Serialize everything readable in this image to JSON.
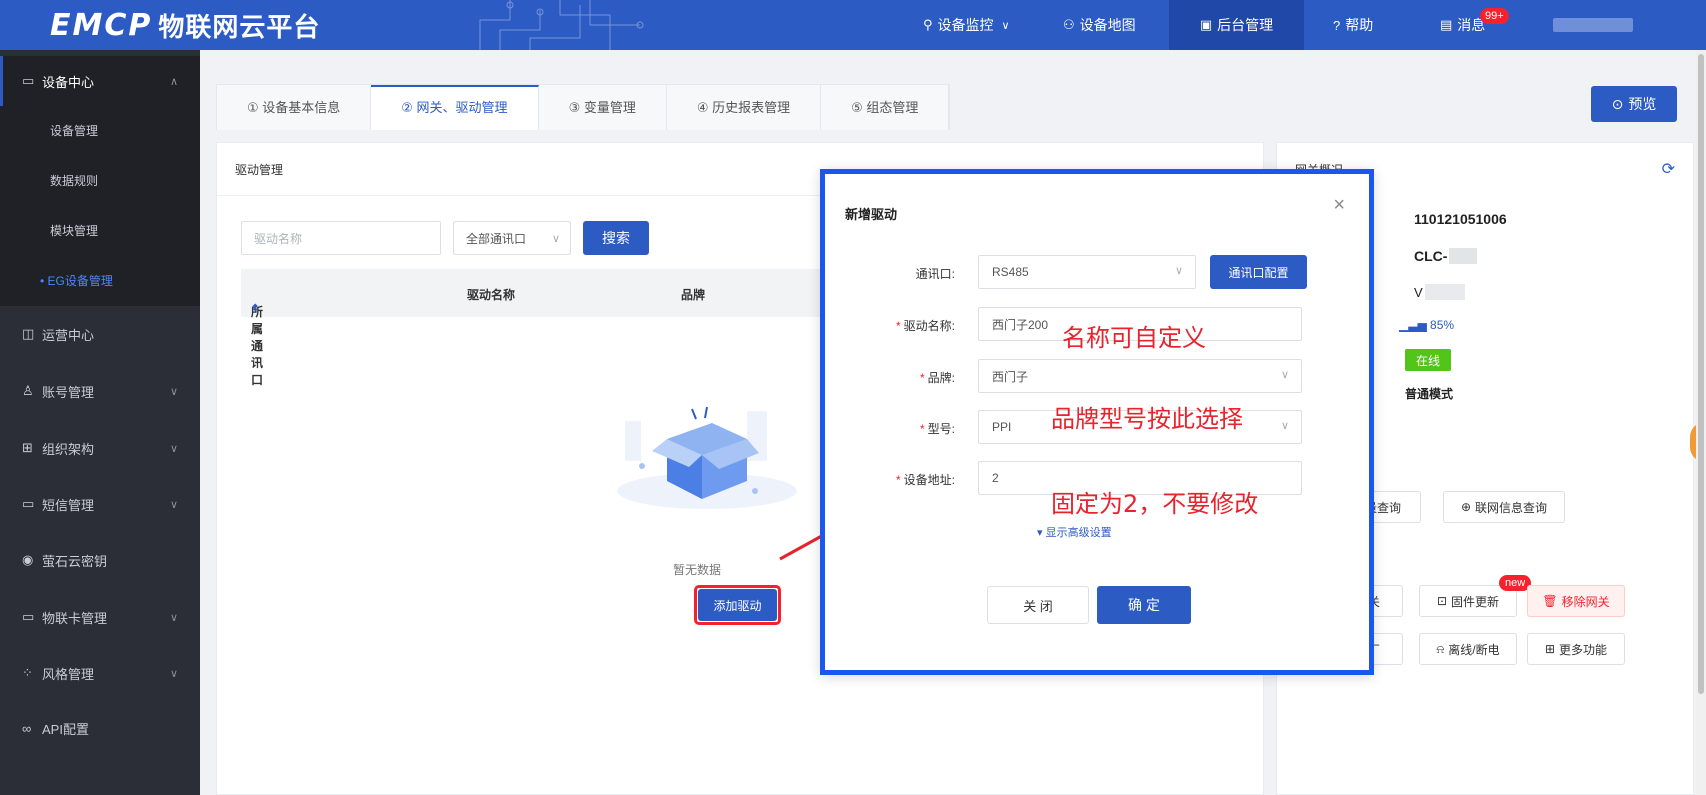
{
  "header": {
    "logo_mark": "EMCP",
    "logo_text": "物联网云平台",
    "nav": [
      {
        "label": "设备监控",
        "icon": "location-pin-icon",
        "has_dropdown": true
      },
      {
        "label": "设备地图",
        "icon": "user-icon"
      },
      {
        "label": "后台管理",
        "icon": "monitor-icon",
        "active": true
      },
      {
        "label": "帮助",
        "icon": "question-icon"
      },
      {
        "label": "消息",
        "icon": "message-icon",
        "badge": "99+"
      }
    ]
  },
  "sidebar": {
    "sections": [
      {
        "label": "设备中心",
        "icon": "device-icon",
        "expanded": true,
        "items": [
          {
            "label": "设备管理"
          },
          {
            "label": "数据规则"
          },
          {
            "label": "模块管理"
          },
          {
            "label": "• EG设备管理",
            "active": true
          }
        ]
      },
      {
        "label": "运营中心",
        "icon": "chart-icon"
      },
      {
        "label": "账号管理",
        "icon": "account-icon",
        "has_children": true
      },
      {
        "label": "组织架构",
        "icon": "org-icon",
        "has_children": true
      },
      {
        "label": "短信管理",
        "icon": "sms-icon",
        "has_children": true
      },
      {
        "label": "萤石云密钥",
        "icon": "key-icon"
      },
      {
        "label": "物联卡管理",
        "icon": "card-icon",
        "has_children": true
      },
      {
        "label": "风格管理",
        "icon": "style-icon",
        "has_children": true
      },
      {
        "label": "API配置",
        "icon": "link-icon"
      }
    ]
  },
  "tabs": [
    {
      "label": "① 设备基本信息"
    },
    {
      "label": "② 网关、驱动管理",
      "active": true
    },
    {
      "label": "③ 变量管理"
    },
    {
      "label": "④ 历史报表管理"
    },
    {
      "label": "⑤ 组态管理"
    }
  ],
  "preview_label": "预览",
  "driver_panel": {
    "title": "驱动管理",
    "search_placeholder": "驱动名称",
    "port_filter": "全部通讯口",
    "search_label": "搜索",
    "columns": [
      "所属通讯口",
      "驱动名称",
      "品牌"
    ],
    "empty_text": "暂无数据",
    "add_label": "添加驱动"
  },
  "gateway_panel": {
    "title_partial": "网关概况",
    "serial": "110121051006",
    "model": "CLC-",
    "version_partial": "V",
    "signal": "85%",
    "status": "在线",
    "mode": "普通模式",
    "row1": [
      "量查询",
      "联网信息查询"
    ],
    "row2": [
      "关",
      "固件更新",
      "移除网关"
    ],
    "row3": [
      "厂",
      "离线/断电",
      "更多功能"
    ],
    "new_badge": "new",
    "color_status": "#52c41a",
    "color_danger": "#f5222d"
  },
  "modal": {
    "title": "新增驱动",
    "fields": [
      {
        "label": "通讯口:",
        "value": "RS485",
        "required": false,
        "dropdown": true
      },
      {
        "label": "驱动名称:",
        "value": "西门子200",
        "required": true,
        "dropdown": false
      },
      {
        "label": "品牌:",
        "value": "西门子",
        "required": true,
        "dropdown": true
      },
      {
        "label": "型号:",
        "value": "PPI",
        "required": true,
        "dropdown": true
      },
      {
        "label": "设备地址:",
        "value": "2",
        "required": true,
        "dropdown": false
      }
    ],
    "port_config_label": "通讯口配置",
    "advanced_label": "▾ 显示高级设置",
    "close_label": "关 闭",
    "confirm_label": "确 定"
  },
  "annotations": {
    "name_note": "名称可自定义",
    "brand_note": "品牌型号按此选择",
    "address_note": "固定为2，不要修改",
    "color": "#e8232d"
  },
  "colors": {
    "primary": "#2c5bc4",
    "sidebar": "#2b2e36",
    "highlight_border": "#1a56f0"
  }
}
